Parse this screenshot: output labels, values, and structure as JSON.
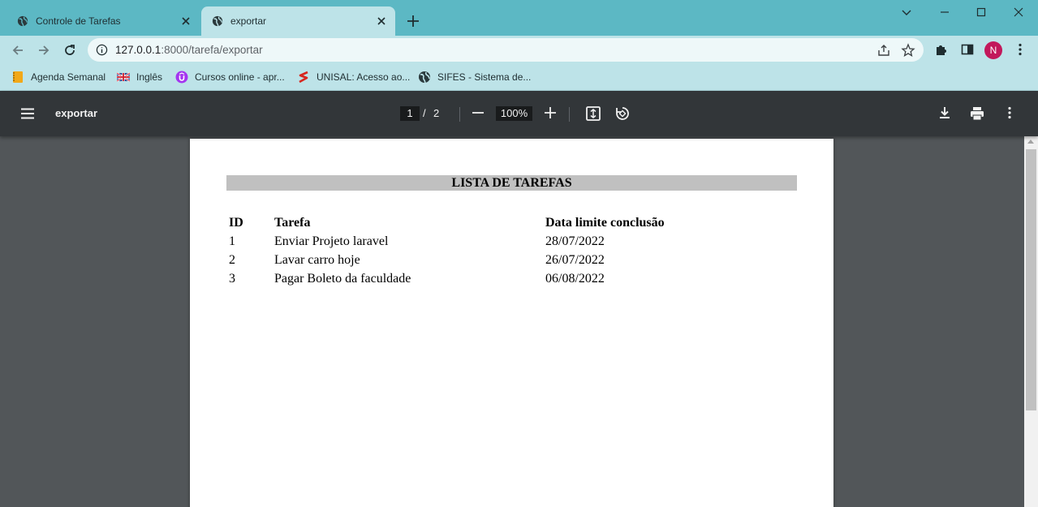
{
  "tabs": [
    {
      "label": "Controle de Tarefas",
      "icon": "globe-icon",
      "active": false
    },
    {
      "label": "exportar",
      "icon": "globe-icon",
      "active": true
    }
  ],
  "omnibox": {
    "host": "127.0.0.1",
    "path": ":8000/tarefa/exportar"
  },
  "profile": {
    "initial": "N",
    "color": "#c2185b"
  },
  "bookmarks": [
    {
      "label": "Agenda Semanal",
      "icon": "notebook-icon"
    },
    {
      "label": "Inglês",
      "icon": "uk-flag-icon"
    },
    {
      "label": "Cursos online - apr...",
      "icon": "udemy-icon"
    },
    {
      "label": "UNISAL: Acesso ao...",
      "icon": "unisal-icon"
    },
    {
      "label": "SIFES - Sistema de...",
      "icon": "globe-icon"
    }
  ],
  "pdf_viewer": {
    "title": "exportar",
    "current_page": "1",
    "separator": "/",
    "total_pages": "2",
    "zoom": "100%"
  },
  "document": {
    "heading": "LISTA DE TAREFAS",
    "columns": [
      "ID",
      "Tarefa",
      "Data limite conclusão"
    ],
    "rows": [
      [
        "1",
        "Enviar Projeto laravel",
        "28/07/2022"
      ],
      [
        "2",
        "Lavar carro hoje",
        "26/07/2022"
      ],
      [
        "3",
        "Pagar Boleto da faculdade",
        "06/08/2022"
      ]
    ]
  },
  "colors": {
    "tabstrip": "#5cb8c4",
    "toolbar": "#bde3e8",
    "pdf_toolbar": "#323639",
    "viewer_background": "#525659",
    "heading_band": "#c0c0c0"
  }
}
